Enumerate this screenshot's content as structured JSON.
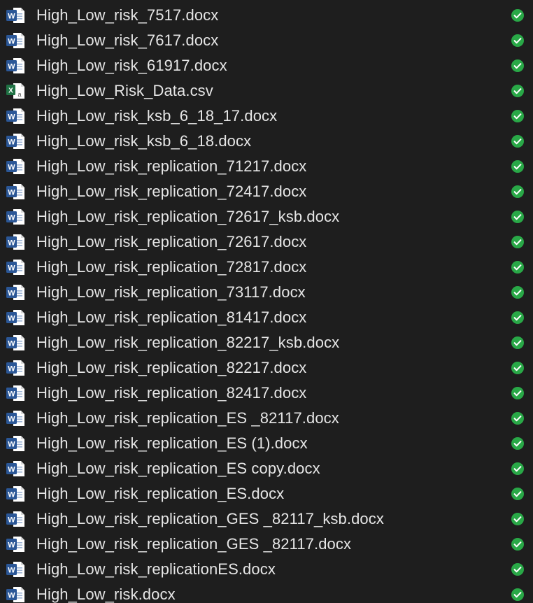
{
  "files": [
    {
      "name": "High_Low_risk_7517.docx",
      "icon": "word-doc-icon",
      "status": "synced-check-icon"
    },
    {
      "name": "High_Low_risk_7617.docx",
      "icon": "word-doc-icon",
      "status": "synced-check-icon"
    },
    {
      "name": "High_Low_risk_61917.docx",
      "icon": "word-doc-icon",
      "status": "synced-check-icon"
    },
    {
      "name": "High_Low_Risk_Data.csv",
      "icon": "excel-csv-icon",
      "status": "synced-check-icon"
    },
    {
      "name": "High_Low_risk_ksb_6_18_17.docx",
      "icon": "word-doc-icon",
      "status": "synced-check-icon"
    },
    {
      "name": "High_Low_risk_ksb_6_18.docx",
      "icon": "word-doc-icon",
      "status": "synced-check-icon"
    },
    {
      "name": "High_Low_risk_replication_71217.docx",
      "icon": "word-doc-icon",
      "status": "synced-check-icon"
    },
    {
      "name": "High_Low_risk_replication_72417.docx",
      "icon": "word-doc-icon",
      "status": "synced-check-icon"
    },
    {
      "name": "High_Low_risk_replication_72617_ksb.docx",
      "icon": "word-doc-icon",
      "status": "synced-check-icon"
    },
    {
      "name": "High_Low_risk_replication_72617.docx",
      "icon": "word-doc-icon",
      "status": "synced-check-icon"
    },
    {
      "name": "High_Low_risk_replication_72817.docx",
      "icon": "word-doc-icon",
      "status": "synced-check-icon"
    },
    {
      "name": "High_Low_risk_replication_73117.docx",
      "icon": "word-doc-icon",
      "status": "synced-check-icon"
    },
    {
      "name": "High_Low_risk_replication_81417.docx",
      "icon": "word-doc-icon",
      "status": "synced-check-icon"
    },
    {
      "name": "High_Low_risk_replication_82217_ksb.docx",
      "icon": "word-doc-icon",
      "status": "synced-check-icon"
    },
    {
      "name": "High_Low_risk_replication_82217.docx",
      "icon": "word-doc-icon",
      "status": "synced-check-icon"
    },
    {
      "name": "High_Low_risk_replication_82417.docx",
      "icon": "word-doc-icon",
      "status": "synced-check-icon"
    },
    {
      "name": "High_Low_risk_replication_ES _82117.docx",
      "icon": "word-doc-icon",
      "status": "synced-check-icon"
    },
    {
      "name": "High_Low_risk_replication_ES (1).docx",
      "icon": "word-doc-icon",
      "status": "synced-check-icon"
    },
    {
      "name": "High_Low_risk_replication_ES copy.docx",
      "icon": "word-doc-icon",
      "status": "synced-check-icon"
    },
    {
      "name": "High_Low_risk_replication_ES.docx",
      "icon": "word-doc-icon",
      "status": "synced-check-icon"
    },
    {
      "name": "High_Low_risk_replication_GES _82117_ksb.docx",
      "icon": "word-doc-icon",
      "status": "synced-check-icon"
    },
    {
      "name": "High_Low_risk_replication_GES _82117.docx",
      "icon": "word-doc-icon",
      "status": "synced-check-icon"
    },
    {
      "name": "High_Low_risk_replicationES.docx",
      "icon": "word-doc-icon",
      "status": "synced-check-icon"
    },
    {
      "name": "High_Low_risk.docx",
      "icon": "word-doc-icon",
      "status": "synced-check-icon"
    }
  ],
  "colors": {
    "background": "#1e1e1e",
    "text": "#e6e6e6",
    "word_blue": "#2b5797",
    "excel_green": "#1f7244",
    "synced_green": "#29a847"
  }
}
